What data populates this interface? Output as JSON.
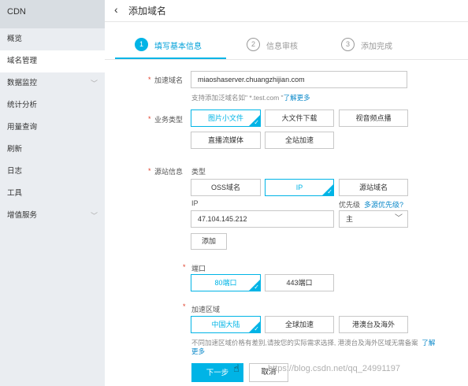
{
  "sidebar": {
    "brand": "CDN",
    "items": [
      {
        "label": "概览"
      },
      {
        "label": "域名管理"
      },
      {
        "label": "数据监控"
      },
      {
        "label": "统计分析"
      },
      {
        "label": "用量查询"
      },
      {
        "label": "刷新"
      },
      {
        "label": "日志"
      },
      {
        "label": "工具"
      },
      {
        "label": "增值服务"
      }
    ]
  },
  "header": {
    "back_icon": "chevron-left-icon",
    "title": "添加域名"
  },
  "steps": [
    {
      "num": "1",
      "label": "填写基本信息"
    },
    {
      "num": "2",
      "label": "信息审核"
    },
    {
      "num": "3",
      "label": "添加完成"
    }
  ],
  "form": {
    "domain": {
      "label": "加速域名",
      "value": "miaoshaserver.chuangzhijian.com",
      "hint": "支持添加泛域名如\" *.test.com \"",
      "hint_link": "了解更多"
    },
    "business_type": {
      "label": "业务类型",
      "options": [
        "图片小文件",
        "大文件下载",
        "视音频点播",
        "直播流媒体",
        "全站加速"
      ],
      "selected": "图片小文件"
    },
    "origin": {
      "label": "源站信息",
      "type_label": "类型",
      "types": [
        "OSS域名",
        "IP",
        "源站域名"
      ],
      "selected_type": "IP",
      "ip_label": "IP",
      "ip_value": "47.104.145.212",
      "priority_label": "优先级",
      "priority_link": "多源优先级?",
      "priority_value": "主",
      "add_label": "添加"
    },
    "port": {
      "label": "端口",
      "options": [
        "80端口",
        "443端口"
      ],
      "selected": "80端口"
    },
    "region": {
      "label": "加速区域",
      "options": [
        "中国大陆",
        "全球加速",
        "港澳台及海外"
      ],
      "selected": "中国大陆",
      "hint_line1": "不同加速区域价格有差别,请按您的实际需求选择, 港澳台及海外区域无需备案",
      "hint_link1": "了解",
      "hint_link2": "更多"
    },
    "next_label": "下一步",
    "cancel_label": "取消"
  },
  "watermark": "https://blog.csdn.net/qq_24991197",
  "colors": {
    "accent": "#00b4e6",
    "link": "#0a88c9",
    "required": "#e0402c"
  }
}
